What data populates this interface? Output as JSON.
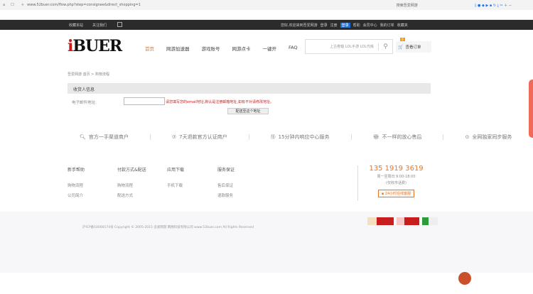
{
  "browser": {
    "url": "www.52buer.com/flow.php?step=consignee&direct_shopping=1",
    "search_hint": "搜索吾爱网游"
  },
  "topbar": {
    "left": [
      "收藏本站",
      "关注我们"
    ],
    "right": [
      "您好,欢迎来到吾爱网游",
      "登录",
      "注册",
      "登录",
      "帮助",
      "会员中心",
      "我的订单",
      "收藏夹"
    ]
  },
  "header": {
    "logo": "iBUER",
    "nav": [
      "首页",
      "网游加速器",
      "游戏账号",
      "网游点卡",
      "一键开",
      "FAQ"
    ],
    "search_placeholder": "上古卷轴 LOL手游 LOL代练",
    "cart_badge": "0",
    "order_link": "查看订单"
  },
  "breadcrumb": "吾爱网游 首页 > 购物流程",
  "section": {
    "title": "收货人信息",
    "email_label": "电子邮件地址:",
    "email_value": "",
    "hint": "请您填写您的email地址,默认是注册邮箱地址,如有不对请修改地址。",
    "submit": "配送至这个地址"
  },
  "features": [
    "官方一手渠道商户",
    "7天退款官方认证商户",
    "15分钟内响应中心服务",
    "不一样的放心售后",
    "全网独家同步服务"
  ],
  "footer": {
    "columns": [
      {
        "title": "新手帮助",
        "links": [
          "购物流程",
          "公司简介"
        ]
      },
      {
        "title": "付款方式&配送",
        "links": [
          "购物流程",
          "配送方式"
        ]
      },
      {
        "title": "应用下载",
        "links": [
          "手机下载"
        ]
      },
      {
        "title": "服务保证",
        "links": [
          "售后保证",
          "退款服务"
        ]
      }
    ],
    "phone": "135 1919 3619",
    "hours": "周一至周日 9:00-18:00",
    "note": "(仅收市话费)",
    "chat": "24小时在线客服"
  },
  "copyright": "沪ICP备10000174号 Copyright © 2005-2015 吾爱网游 网络科技有限公司 www.52buer.com All Rights Reserved",
  "colors": {
    "accent": "#e4782a",
    "red": "#c81d1d",
    "dark": "#2b2b2b"
  }
}
